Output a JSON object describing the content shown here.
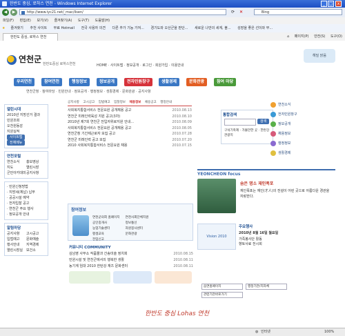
{
  "window": {
    "title": "한반도 중심, 로하스 연천 - Windows Internet Explorer",
    "min": "_",
    "max": "□",
    "close": "x"
  },
  "address": {
    "url": "http://www.iyc21.net/_mac/ilsen/",
    "search_engine": "Bing"
  },
  "menu": [
    "파일(F)",
    "편집(E)",
    "보기(V)",
    "즐겨찾기(A)",
    "도구(T)",
    "도움말(H)"
  ],
  "favorites": {
    "label": "즐겨찾기",
    "items": [
      "추천 사이트",
      "무료 Hotmail",
      "전국 사용자 의견",
      "다른 추가 기능 가져...",
      "경기도와 오산군을 판단...",
      "새로운 나만의 세계, 블...",
      "성장을 좋은 선이와 부..."
    ]
  },
  "tab": {
    "label": "한반도 중심, 로하스 연천"
  },
  "commands": [
    "페이지(P)",
    "안전(S)",
    "도구(O)"
  ],
  "header": {
    "logo": "연천군",
    "slogan": "한반도중심 로하스연천",
    "util_nav": "HOME · 사이트맵 · 정보공개 · 로그인 · 회원가입 · 이용안내",
    "weather": "해밀  맑음"
  },
  "main_nav": [
    "우리연천",
    "참여연천",
    "행정정보",
    "정보공개",
    "전자민원창구",
    "생활경제",
    "문화관광",
    "참여 마당"
  ],
  "sub_nav": "연천군청 · 참여마당 · 민원안내 · 정보공개 · 행정정보 · 생활경제 · 문화관광 · 공지사항",
  "left": {
    "election_title": "열린시대",
    "election_items": [
      "2010년 지방선거 결과",
      "민원조회",
      "오천원동감",
      "지원실적"
    ],
    "btn_a": "사이트맵",
    "btn_b": "전체메뉴",
    "info_title": "연천포털",
    "links": [
      "연천소식",
      "홍보영상",
      "지도",
      "열린시장",
      "군민아카데미",
      "공지사항"
    ],
    "bottom_links": [
      "· 민원신청방법",
      "· 지방세(체납) 납부",
      "· 공공시설 예약",
      "· 전자입찰 공고",
      "· 연천군 주요 행사",
      "· 정보공개 안내"
    ],
    "quick_title": "알림마당",
    "quick_links": [
      "공지사항",
      "고시공고",
      "입법예고",
      "문화예술",
      "행사안내",
      "지역경제",
      "열린시장실",
      "보건소"
    ]
  },
  "news": {
    "tabs": [
      "공지사항",
      "고시공고",
      "입법예고",
      "입찰정보",
      "채용정보",
      "채용공고",
      "행정안내"
    ],
    "active_tab": "채용정보",
    "items": [
      {
        "title": "사회복지통합서비스 전문요원 공개채용 공고",
        "date": "2010.08.13"
      },
      {
        "title": "연천군 미래인력육성 지원 공고(3차)",
        "date": "2010.08.10"
      },
      {
        "title": "2010년 제7회 연천군 전입자위로지원 안내...",
        "date": "2010.08.09"
      },
      {
        "title": "사회복지통합서비스 전문요원 공개채용 공고",
        "date": "2010.08.05"
      },
      {
        "title": "연천군청 기간제근로자 모집 공고",
        "date": "2010.07.28"
      },
      {
        "title": "연천군 미래인력 공고 모집",
        "date": "2010.07.20"
      },
      {
        "title": "2010 사회복지통합서비스 전문요원 채용",
        "date": "2010.07.15"
      }
    ]
  },
  "quick": {
    "title": "참여정보",
    "items": [
      "연천군의회 홈페이지",
      "연천사회단체지원",
      "공인중개사",
      "정보통신",
      "농업기술센터",
      "자원봉사센터",
      "평생교육",
      "문화관광",
      "전입신고"
    ]
  },
  "community": {
    "title": "커뮤니티 COMMUNITY",
    "items": [
      {
        "title": "김남영 사무소 작품몰과 간송미술 정치회",
        "date": "2010.08.15"
      },
      {
        "title": "민원시설 및 연천군에서의 행복한 생활",
        "date": "2010.08.11"
      },
      {
        "title": "농기계 임대 2010 한탄강 재즈 문화센터",
        "date": "2010.08.11"
      }
    ]
  },
  "right": {
    "search_title": "통합검색",
    "search_btn": "검색",
    "menu_items": [
      "연천소식",
      "전자민원창구",
      "정보공개",
      "채용정보",
      "행정정보",
      "생활경제"
    ],
    "promo": "구석기축제 · 가볼만한 곳 · 한탄강 관광지",
    "focus_title": "YEONCHEON focus",
    "focus_headline": "숨은 명소 재인폭포",
    "focus_text": "재인폭포는 재인(才人)의 전설이 어린 곳으로 아름다운 경관을 자랑한다.",
    "calendar_title": "주요행사",
    "calendar_date": "2010년 8월 16일 월요일",
    "events": [
      "가족봉사단 활동",
      "향토사료 전시회"
    ],
    "vision_title": "Vision 2010"
  },
  "selects": [
    "읍면홈페이지",
    "관련기관바로가기",
    "행정기관/지자체"
  ],
  "footer": "한반도 중심 Lohas 연천",
  "status": {
    "left": "",
    "zone": "인터넷",
    "zoom": "100%"
  }
}
